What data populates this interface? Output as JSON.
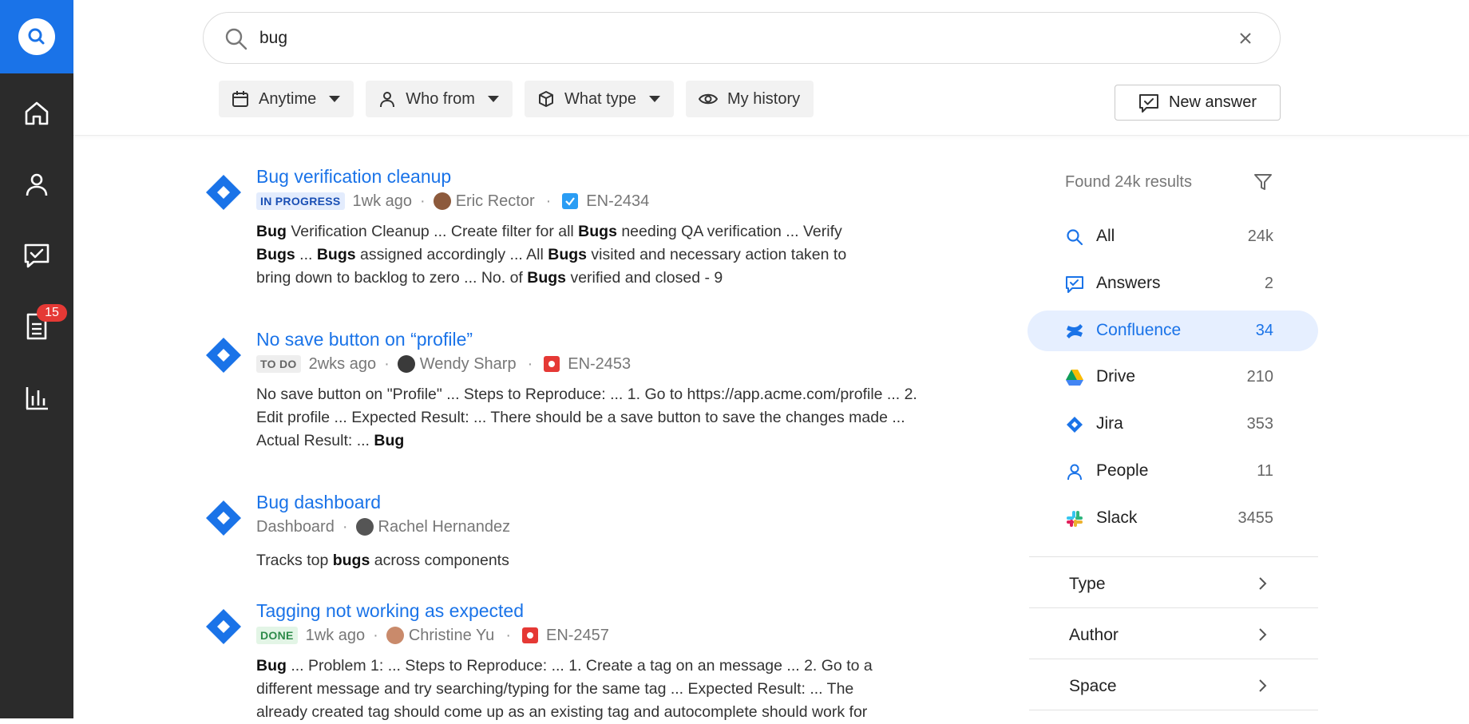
{
  "rail": {
    "badge_count": "15",
    "items": [
      "home-icon",
      "person-icon",
      "answers-icon",
      "document-icon",
      "analytics-icon"
    ]
  },
  "search": {
    "value": "bug",
    "placeholder": ""
  },
  "filters": [
    {
      "label": "Anytime",
      "icon": "calendar-icon",
      "dropdown": true
    },
    {
      "label": "Who from",
      "icon": "person-icon",
      "dropdown": true
    },
    {
      "label": "What type",
      "icon": "cube-icon",
      "dropdown": true
    },
    {
      "label": "My history",
      "icon": "eye-icon",
      "dropdown": false
    }
  ],
  "new_answer_label": "New answer",
  "results": [
    {
      "title": "Bug verification cleanup",
      "status": "IN PROGRESS",
      "time": "1wk ago",
      "author": "Eric Rector",
      "ticket": "EN-2434"
    },
    {
      "title": "No save button on “profile”",
      "status": "TO DO",
      "time": "2wks ago",
      "author": "Wendy Sharp",
      "ticket": "EN-2453"
    },
    {
      "title": "Bug dashboard",
      "type": "Dashboard",
      "author": "Rachel Hernandez",
      "snippet_pre": "Tracks top ",
      "snippet_bold": "bugs",
      "snippet_post": " across components"
    },
    {
      "title": "Tagging not working as expected",
      "status": "DONE",
      "time": "1wk ago",
      "author": "Christine Yu",
      "ticket": "EN-2457"
    }
  ],
  "panel": {
    "found": "Found 24k results",
    "sources": [
      {
        "label": "All",
        "count": "24k",
        "icon": "search-icon"
      },
      {
        "label": "Answers",
        "count": "2",
        "icon": "answers-icon"
      },
      {
        "label": "Confluence",
        "count": "34",
        "icon": "confluence-icon",
        "active": true
      },
      {
        "label": "Drive",
        "count": "210",
        "icon": "drive-icon"
      },
      {
        "label": "Jira",
        "count": "353",
        "icon": "jira-icon"
      },
      {
        "label": "People",
        "count": "11",
        "icon": "people-icon"
      },
      {
        "label": "Slack",
        "count": "3455",
        "icon": "slack-icon"
      }
    ],
    "facets": [
      "Type",
      "Author",
      "Space"
    ]
  },
  "colors": {
    "accent": "#1a73e8",
    "rail": "#2b2b2b",
    "in_progress_bg": "#e3ecfd",
    "in_progress_fg": "#1a4fb4",
    "todo_bg": "#eeeeee",
    "todo_fg": "#666666",
    "done_bg": "#e3f5e6",
    "done_fg": "#2e8b4a",
    "badge": "#e53935"
  }
}
